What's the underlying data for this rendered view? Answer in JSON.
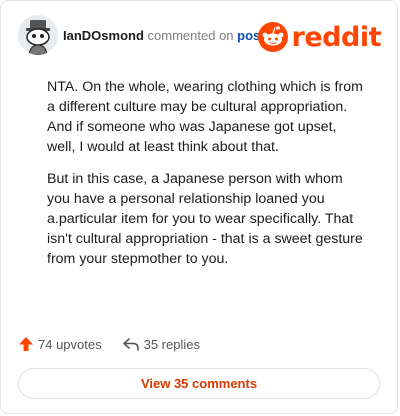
{
  "header": {
    "username": "IanDOsmond",
    "action": "commented on",
    "link": "post",
    "logo_text": "reddit",
    "avatar_icon": "snoo-avatar-icon",
    "logo_icon": "reddit-snoo-icon"
  },
  "comment": {
    "paragraphs": [
      "NTA. On the whole, wearing clothing which is from a different culture may be cultural appropriation. And if someone who was Japanese got upset, well, I would at least think about that.",
      "But in this case, a Japanese person with whom you have a personal relationship loaned you a.particular item for you to wear specifically. That isn't cultural appropriation - that is a sweet gesture from your stepmother to you."
    ]
  },
  "actions": {
    "upvotes": "74 upvotes",
    "replies": "35 replies",
    "upvote_icon": "upvote-arrow-icon",
    "reply_icon": "reply-arrow-icon"
  },
  "footer": {
    "view_comments": "View 35 comments"
  },
  "colors": {
    "brand": "#ff4500",
    "link": "#0a4fb3",
    "button_text": "#d93a00"
  }
}
